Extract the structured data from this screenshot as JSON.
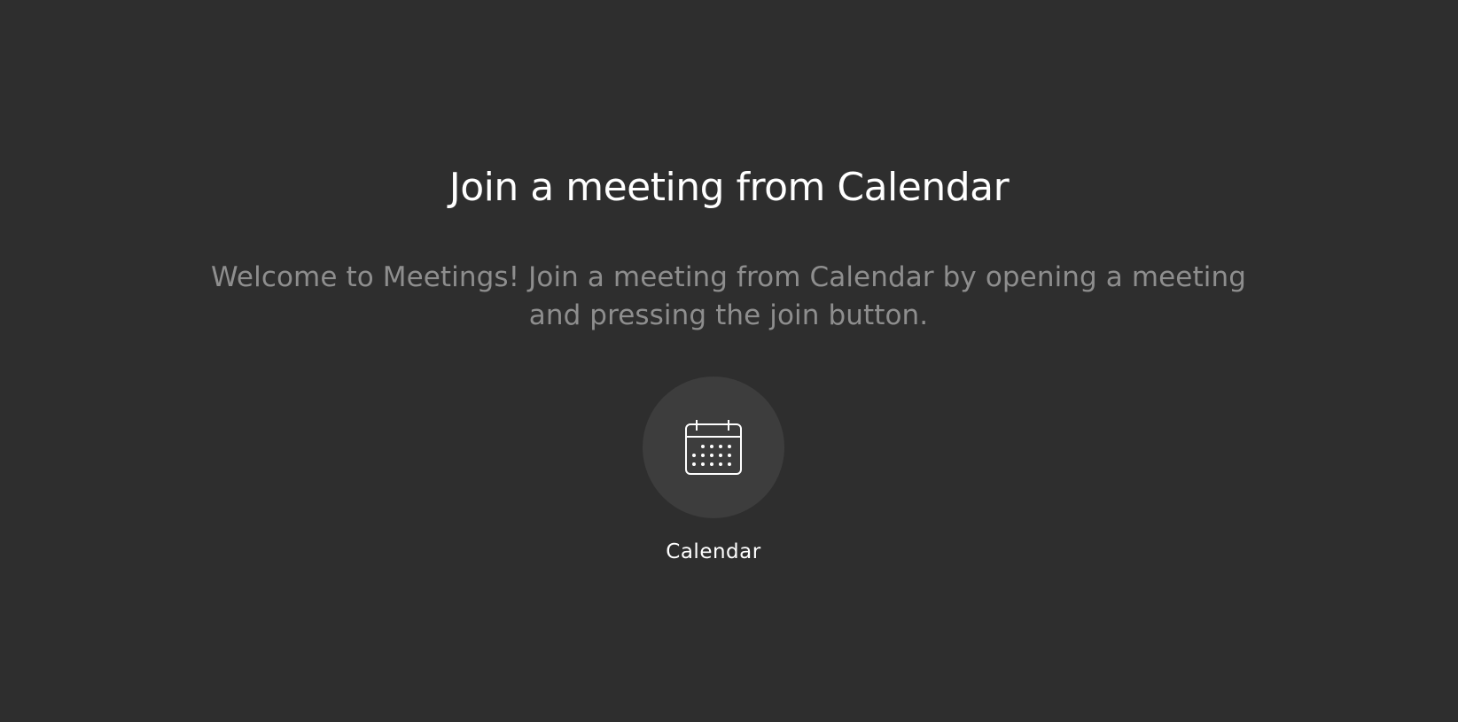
{
  "page": {
    "title": "Join a meeting from Calendar",
    "subtitle": "Welcome to Meetings! Join a meeting from Calendar by opening a meeting and pressing the join button."
  },
  "calendar_button": {
    "icon": "calendar-icon",
    "label": "Calendar"
  },
  "colors": {
    "background": "#2e2e2e",
    "title": "#ffffff",
    "subtitle": "#8e8e8e",
    "button_background": "#3d3d3d",
    "icon_stroke": "#ffffff"
  }
}
